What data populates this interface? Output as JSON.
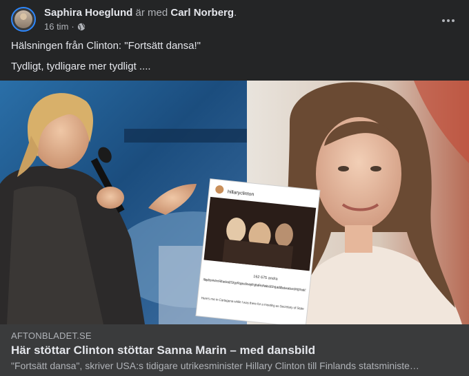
{
  "post": {
    "author": "Saphira Hoeglund",
    "with_text": "är med",
    "tagged": "Carl Norberg",
    "period": ".",
    "time": "16 tim",
    "separator": "·",
    "audience_icon": "globe-icon",
    "more_icon": "more-dots-icon",
    "text_line_1": "Hälsningen från Clinton: \"Fortsätt dansa!\"",
    "text_line_2": "Tydligt, tydligare mer tydligt ...."
  },
  "inset": {
    "handle": "hillaryclinton",
    "likes": "162 675 andra",
    "caption": "hillaryclinton As Ann Richards said, \"Ginger Rogers did everything that Fred Astaire did. She just did it backwards and in high heels.\"",
    "caption2": "Here's me in Cartagena while I was there for a meeting as Secretary of State"
  },
  "link": {
    "domain": "AFTONBLADET.SE",
    "title": "Här stöttar Clinton stöttar Sanna Marin – med dansbild",
    "description": "\"Fortsätt dansa\", skriver USA:s tidigare utrikesminister Hillary Clinton till Finlands statsministe…"
  },
  "colors": {
    "background": "#242526",
    "link_card": "#3a3b3c",
    "primary_text": "#e4e6eb",
    "secondary_text": "#b0b3b8",
    "avatar_ring": "#2d88ff"
  }
}
